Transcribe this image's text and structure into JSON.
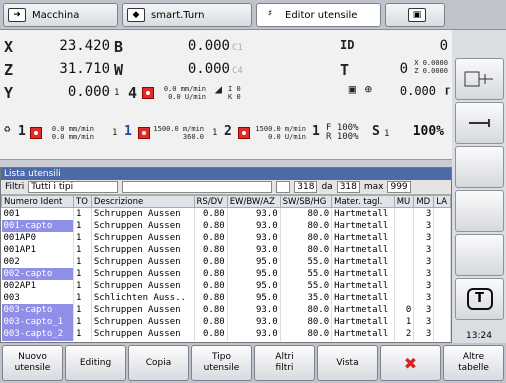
{
  "tabs": [
    {
      "label": "Macchina",
      "icon": "arrow-right-icon"
    },
    {
      "label": "smart.Turn",
      "icon": "diamond-arrow-icon"
    },
    {
      "label": "Editor utensile",
      "icon": "tool-icon"
    },
    {
      "label": "",
      "icon": "save-icon"
    }
  ],
  "dro": {
    "x": {
      "axis": "X",
      "value": "23.420"
    },
    "z": {
      "axis": "Z",
      "value": "31.710"
    },
    "y": {
      "axis": "Y",
      "value": "0.000"
    },
    "b": {
      "axis": "B",
      "value": "0.000",
      "sub": "C",
      "sub_idx": "1"
    },
    "w": {
      "axis": "W",
      "value": "0.000",
      "sub": "C",
      "sub_idx": "4"
    },
    "id": {
      "label": "ID",
      "value": "0"
    },
    "t": {
      "label": "T",
      "value": "0",
      "x_label": "X",
      "x_val": "0.0000",
      "z_label": "Z",
      "z_val": "0.0000"
    },
    "feed1": {
      "a": "0.0 mm/min",
      "b": "0.0 U/min"
    },
    "ij": {
      "i": "I",
      "i_val": "0",
      "k": "K",
      "k_val": "0"
    },
    "misc_value": "0.000",
    "spindle_left": {
      "num": "1",
      "label": "4",
      "a": "0.0 mm/min",
      "b": "0.0 mm/min"
    },
    "s1": {
      "idx": "1",
      "num": "1",
      "a": "1500.0 m/min",
      "b": "360.0"
    },
    "s2": {
      "idx": "1",
      "num": "2",
      "a": "1500.0 m/min",
      "b": "0.0 U/min"
    },
    "override": {
      "num": "1",
      "f": "F 100%",
      "r": "R 100%",
      "s_label": "S",
      "s_idx": "1",
      "s_val": "100%"
    }
  },
  "list": {
    "title": "Lista utensili",
    "filter_label": "Filtri",
    "filter_value": "Tutti i tipi",
    "count": "318",
    "of_label": "da",
    "total": "318",
    "max_label": "max",
    "max": "999",
    "columns": [
      "Numero Ident",
      "TO",
      "Descrizione",
      "RS/DV",
      "EW/BW/AZ",
      "SW/SB/HG",
      "Mater. tagl.",
      "MU",
      "MD",
      "LA"
    ],
    "rows": [
      {
        "id": "001",
        "to": "1",
        "desc": "Schruppen Aussen",
        "rs": "0.80",
        "ew": "93.0",
        "sw": "80.0",
        "mat": "Hartmetall",
        "mu": "",
        "md": "3",
        "la": "",
        "hl": false
      },
      {
        "id": "001-capto",
        "to": "1",
        "desc": "Schruppen Aussen",
        "rs": "0.80",
        "ew": "93.0",
        "sw": "80.0",
        "mat": "Hartmetall",
        "mu": "",
        "md": "3",
        "la": "",
        "hl": true
      },
      {
        "id": "001AP0",
        "to": "1",
        "desc": "Schruppen Aussen",
        "rs": "0.80",
        "ew": "93.0",
        "sw": "80.0",
        "mat": "Hartmetall",
        "mu": "",
        "md": "3",
        "la": "",
        "hl": false
      },
      {
        "id": "001AP1",
        "to": "1",
        "desc": "Schruppen Aussen",
        "rs": "0.80",
        "ew": "93.0",
        "sw": "80.0",
        "mat": "Hartmetall",
        "mu": "",
        "md": "3",
        "la": "",
        "hl": false
      },
      {
        "id": "002",
        "to": "1",
        "desc": "Schruppen Aussen",
        "rs": "0.80",
        "ew": "95.0",
        "sw": "55.0",
        "mat": "Hartmetall",
        "mu": "",
        "md": "3",
        "la": "",
        "hl": false
      },
      {
        "id": "002-capto",
        "to": "1",
        "desc": "Schruppen Aussen",
        "rs": "0.80",
        "ew": "95.0",
        "sw": "55.0",
        "mat": "Hartmetall",
        "mu": "",
        "md": "3",
        "la": "",
        "hl": true
      },
      {
        "id": "002AP1",
        "to": "1",
        "desc": "Schruppen Aussen",
        "rs": "0.80",
        "ew": "95.0",
        "sw": "55.0",
        "mat": "Hartmetall",
        "mu": "",
        "md": "3",
        "la": "",
        "hl": false
      },
      {
        "id": "003",
        "to": "1",
        "desc": "Schlichten Auss..",
        "rs": "0.80",
        "ew": "95.0",
        "sw": "35.0",
        "mat": "Hartmetall",
        "mu": "",
        "md": "3",
        "la": "",
        "hl": false
      },
      {
        "id": "003-capto",
        "to": "1",
        "desc": "Schruppen Aussen",
        "rs": "0.80",
        "ew": "93.0",
        "sw": "80.0",
        "mat": "Hartmetall",
        "mu": "0",
        "md": "3",
        "la": "",
        "hl": true
      },
      {
        "id": "003-capto_1",
        "to": "1",
        "desc": "Schruppen Aussen",
        "rs": "0.80",
        "ew": "93.0",
        "sw": "80.0",
        "mat": "Hartmetall",
        "mu": "1",
        "md": "3",
        "la": "",
        "hl": true
      },
      {
        "id": "003-capto_2",
        "to": "1",
        "desc": "Schruppen Aussen",
        "rs": "0.80",
        "ew": "93.0",
        "sw": "80.0",
        "mat": "Hartmetall",
        "mu": "2",
        "md": "3",
        "la": "",
        "hl": true
      }
    ]
  },
  "softkeys": [
    "Nuovo\nutensile",
    "Editing",
    "Copia",
    "Tipo\nutensile",
    "Altri\nfiltri",
    "Vista",
    "",
    "Altre\ntabelle"
  ],
  "clock": "13:24",
  "colors": {
    "accent": "#4c6aa8",
    "highlight": "#8f8fe8",
    "red": "#e12a2a"
  }
}
